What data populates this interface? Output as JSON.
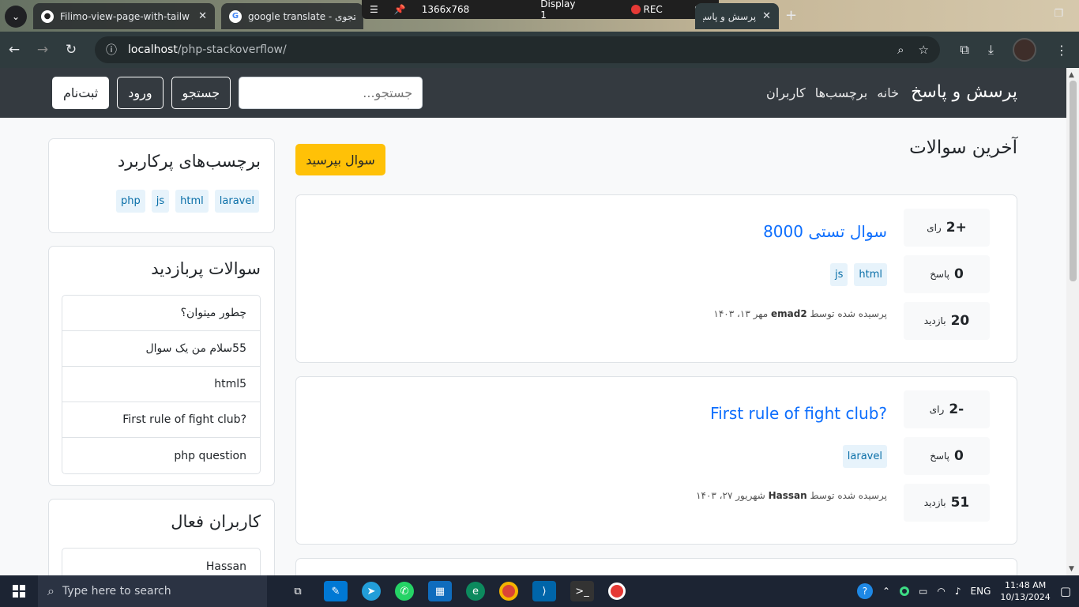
{
  "browser": {
    "tabs": [
      {
        "title": "Filimo-view-page-with-tailwind",
        "favicon": "github-icon"
      },
      {
        "title": "google translate - جستجوی",
        "favicon": "google-icon"
      },
      {
        "title": "پرسش و پاسخ",
        "favicon": "page-icon"
      }
    ],
    "recorder": {
      "resolution": "1366x768",
      "display": "Display 1",
      "rec_label": "REC"
    },
    "url_host": "localhost",
    "url_path": "/php-stackoverflow/"
  },
  "nav": {
    "brand": "پرسش و پاسخ",
    "links": [
      "خانه",
      "برچسب‌ها",
      "کاربران"
    ],
    "search_placeholder": "جستجو...",
    "search_button": "جستجو",
    "login_button": "ورود",
    "register_button": "ثبت‌نام"
  },
  "main": {
    "title": "آخرین سوالات",
    "ask_button": "سوال بپرسید",
    "questions": [
      {
        "votes": "+2",
        "votes_label": "رای",
        "answers": "0",
        "answers_label": "پاسخ",
        "views": "20",
        "views_label": "بازدید",
        "title": "سوال تستی 8000",
        "tags": [
          "html",
          "js"
        ],
        "meta_prefix": "پرسیده شده توسط",
        "author": "emad2",
        "date": "مهر ۱۳، ۱۴۰۳"
      },
      {
        "votes": "-2",
        "votes_label": "رای",
        "answers": "0",
        "answers_label": "پاسخ",
        "views": "51",
        "views_label": "بازدید",
        "title": "First rule of fight club?",
        "tags": [
          "laravel"
        ],
        "meta_prefix": "پرسیده شده توسط",
        "author": "Hassan",
        "date": "شهریور ۲۷، ۱۴۰۳"
      }
    ]
  },
  "sidebar": {
    "popular_tags_title": "برچسب‌های پرکاربرد",
    "popular_tags": [
      "laravel",
      "html",
      "js",
      "php"
    ],
    "most_viewed_title": "سوالات پربازدید",
    "most_viewed": [
      "چطور میتوان؟",
      "55سلام من یک سوال",
      "html5",
      "First rule of fight club?",
      "php question"
    ],
    "active_users_title": "کاربران فعال",
    "active_users": [
      "Hassan"
    ]
  },
  "taskbar": {
    "search_placeholder": "Type here to search",
    "language": "ENG",
    "time": "11:48 AM",
    "date": "10/13/2024"
  },
  "colors": {
    "navbar": "#343a40",
    "link": "#0d6efd",
    "ask_button": "#ffc107",
    "tag_bg": "#e7f3fb"
  }
}
